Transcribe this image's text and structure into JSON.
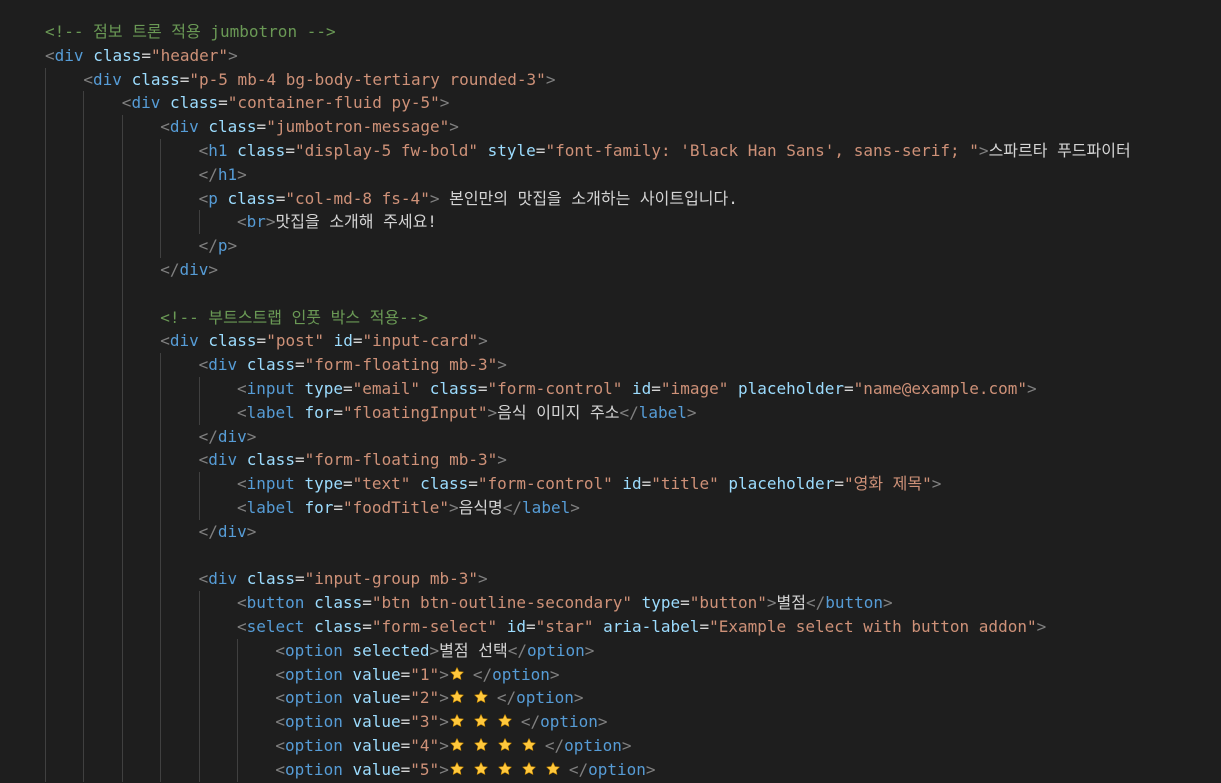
{
  "lines": [
    {
      "indent": 0,
      "tokens": [
        {
          "t": "c",
          "v": "<!-- 점보 트론 적용 jumbotron -->"
        }
      ]
    },
    {
      "indent": 0,
      "tokens": [
        {
          "t": "p",
          "v": "<"
        },
        {
          "t": "g",
          "v": "div"
        },
        {
          "t": "s",
          "v": " "
        },
        {
          "t": "a",
          "v": "class"
        },
        {
          "t": "e",
          "v": "="
        },
        {
          "t": "q",
          "v": "\"header\""
        },
        {
          "t": "p",
          "v": ">"
        }
      ]
    },
    {
      "indent": 1,
      "tokens": [
        {
          "t": "p",
          "v": "<"
        },
        {
          "t": "g",
          "v": "div"
        },
        {
          "t": "s",
          "v": " "
        },
        {
          "t": "a",
          "v": "class"
        },
        {
          "t": "e",
          "v": "="
        },
        {
          "t": "q",
          "v": "\"p-5 mb-4 bg-body-tertiary rounded-3\""
        },
        {
          "t": "p",
          "v": ">"
        }
      ]
    },
    {
      "indent": 2,
      "tokens": [
        {
          "t": "p",
          "v": "<"
        },
        {
          "t": "g",
          "v": "div"
        },
        {
          "t": "s",
          "v": " "
        },
        {
          "t": "a",
          "v": "class"
        },
        {
          "t": "e",
          "v": "="
        },
        {
          "t": "q",
          "v": "\"container-fluid py-5\""
        },
        {
          "t": "p",
          "v": ">"
        }
      ]
    },
    {
      "indent": 3,
      "tokens": [
        {
          "t": "p",
          "v": "<"
        },
        {
          "t": "g",
          "v": "div"
        },
        {
          "t": "s",
          "v": " "
        },
        {
          "t": "a",
          "v": "class"
        },
        {
          "t": "e",
          "v": "="
        },
        {
          "t": "q",
          "v": "\"jumbotron-message\""
        },
        {
          "t": "p",
          "v": ">"
        }
      ]
    },
    {
      "indent": 4,
      "tokens": [
        {
          "t": "p",
          "v": "<"
        },
        {
          "t": "g",
          "v": "h1"
        },
        {
          "t": "s",
          "v": " "
        },
        {
          "t": "a",
          "v": "class"
        },
        {
          "t": "e",
          "v": "="
        },
        {
          "t": "q",
          "v": "\"display-5 fw-bold\""
        },
        {
          "t": "s",
          "v": " "
        },
        {
          "t": "a",
          "v": "style"
        },
        {
          "t": "e",
          "v": "="
        },
        {
          "t": "q",
          "v": "\"font-family: 'Black Han Sans', sans-serif; \""
        },
        {
          "t": "p",
          "v": ">"
        },
        {
          "t": "x",
          "v": "스파르타 푸드파이터"
        }
      ]
    },
    {
      "indent": 4,
      "tokens": [
        {
          "t": "p",
          "v": "</"
        },
        {
          "t": "g",
          "v": "h1"
        },
        {
          "t": "p",
          "v": ">"
        }
      ]
    },
    {
      "indent": 4,
      "tokens": [
        {
          "t": "p",
          "v": "<"
        },
        {
          "t": "g",
          "v": "p"
        },
        {
          "t": "s",
          "v": " "
        },
        {
          "t": "a",
          "v": "class"
        },
        {
          "t": "e",
          "v": "="
        },
        {
          "t": "q",
          "v": "\"col-md-8 fs-4\""
        },
        {
          "t": "p",
          "v": ">"
        },
        {
          "t": "x",
          "v": " 본인만의 맛집을 소개하는 사이트입니다."
        }
      ]
    },
    {
      "indent": 5,
      "tokens": [
        {
          "t": "p",
          "v": "<"
        },
        {
          "t": "g",
          "v": "br"
        },
        {
          "t": "p",
          "v": ">"
        },
        {
          "t": "x",
          "v": "맛집을 소개해 주세요!"
        }
      ]
    },
    {
      "indent": 4,
      "tokens": [
        {
          "t": "p",
          "v": "</"
        },
        {
          "t": "g",
          "v": "p"
        },
        {
          "t": "p",
          "v": ">"
        }
      ]
    },
    {
      "indent": 3,
      "tokens": [
        {
          "t": "p",
          "v": "</"
        },
        {
          "t": "g",
          "v": "div"
        },
        {
          "t": "p",
          "v": ">"
        }
      ]
    },
    {
      "indent": 3,
      "tokens": []
    },
    {
      "indent": 3,
      "tokens": [
        {
          "t": "c",
          "v": "<!-- 부트스트랩 인풋 박스 적용-->"
        }
      ]
    },
    {
      "indent": 3,
      "tokens": [
        {
          "t": "p",
          "v": "<"
        },
        {
          "t": "g",
          "v": "div"
        },
        {
          "t": "s",
          "v": " "
        },
        {
          "t": "a",
          "v": "class"
        },
        {
          "t": "e",
          "v": "="
        },
        {
          "t": "q",
          "v": "\"post\""
        },
        {
          "t": "s",
          "v": " "
        },
        {
          "t": "a",
          "v": "id"
        },
        {
          "t": "e",
          "v": "="
        },
        {
          "t": "q",
          "v": "\"input-card\""
        },
        {
          "t": "p",
          "v": ">"
        }
      ]
    },
    {
      "indent": 4,
      "tokens": [
        {
          "t": "p",
          "v": "<"
        },
        {
          "t": "g",
          "v": "div"
        },
        {
          "t": "s",
          "v": " "
        },
        {
          "t": "a",
          "v": "class"
        },
        {
          "t": "e",
          "v": "="
        },
        {
          "t": "q",
          "v": "\"form-floating mb-3\""
        },
        {
          "t": "p",
          "v": ">"
        }
      ]
    },
    {
      "indent": 5,
      "tokens": [
        {
          "t": "p",
          "v": "<"
        },
        {
          "t": "g",
          "v": "input"
        },
        {
          "t": "s",
          "v": " "
        },
        {
          "t": "a",
          "v": "type"
        },
        {
          "t": "e",
          "v": "="
        },
        {
          "t": "q",
          "v": "\"email\""
        },
        {
          "t": "s",
          "v": " "
        },
        {
          "t": "a",
          "v": "class"
        },
        {
          "t": "e",
          "v": "="
        },
        {
          "t": "q",
          "v": "\"form-control\""
        },
        {
          "t": "s",
          "v": " "
        },
        {
          "t": "a",
          "v": "id"
        },
        {
          "t": "e",
          "v": "="
        },
        {
          "t": "q",
          "v": "\"image\""
        },
        {
          "t": "s",
          "v": " "
        },
        {
          "t": "a",
          "v": "placeholder"
        },
        {
          "t": "e",
          "v": "="
        },
        {
          "t": "q",
          "v": "\"name@example.com\""
        },
        {
          "t": "p",
          "v": ">"
        }
      ]
    },
    {
      "indent": 5,
      "tokens": [
        {
          "t": "p",
          "v": "<"
        },
        {
          "t": "g",
          "v": "label"
        },
        {
          "t": "s",
          "v": " "
        },
        {
          "t": "a",
          "v": "for"
        },
        {
          "t": "e",
          "v": "="
        },
        {
          "t": "q",
          "v": "\"floatingInput\""
        },
        {
          "t": "p",
          "v": ">"
        },
        {
          "t": "x",
          "v": "음식 이미지 주소"
        },
        {
          "t": "p",
          "v": "</"
        },
        {
          "t": "g",
          "v": "label"
        },
        {
          "t": "p",
          "v": ">"
        }
      ]
    },
    {
      "indent": 4,
      "tokens": [
        {
          "t": "p",
          "v": "</"
        },
        {
          "t": "g",
          "v": "div"
        },
        {
          "t": "p",
          "v": ">"
        }
      ]
    },
    {
      "indent": 4,
      "tokens": [
        {
          "t": "p",
          "v": "<"
        },
        {
          "t": "g",
          "v": "div"
        },
        {
          "t": "s",
          "v": " "
        },
        {
          "t": "a",
          "v": "class"
        },
        {
          "t": "e",
          "v": "="
        },
        {
          "t": "q",
          "v": "\"form-floating mb-3\""
        },
        {
          "t": "p",
          "v": ">"
        }
      ]
    },
    {
      "indent": 5,
      "tokens": [
        {
          "t": "p",
          "v": "<"
        },
        {
          "t": "g",
          "v": "input"
        },
        {
          "t": "s",
          "v": " "
        },
        {
          "t": "a",
          "v": "type"
        },
        {
          "t": "e",
          "v": "="
        },
        {
          "t": "q",
          "v": "\"text\""
        },
        {
          "t": "s",
          "v": " "
        },
        {
          "t": "a",
          "v": "class"
        },
        {
          "t": "e",
          "v": "="
        },
        {
          "t": "q",
          "v": "\"form-control\""
        },
        {
          "t": "s",
          "v": " "
        },
        {
          "t": "a",
          "v": "id"
        },
        {
          "t": "e",
          "v": "="
        },
        {
          "t": "q",
          "v": "\"title\""
        },
        {
          "t": "s",
          "v": " "
        },
        {
          "t": "a",
          "v": "placeholder"
        },
        {
          "t": "e",
          "v": "="
        },
        {
          "t": "q",
          "v": "\"영화 제목\""
        },
        {
          "t": "p",
          "v": ">"
        }
      ]
    },
    {
      "indent": 5,
      "tokens": [
        {
          "t": "p",
          "v": "<"
        },
        {
          "t": "g",
          "v": "label"
        },
        {
          "t": "s",
          "v": " "
        },
        {
          "t": "a",
          "v": "for"
        },
        {
          "t": "e",
          "v": "="
        },
        {
          "t": "q",
          "v": "\"foodTitle\""
        },
        {
          "t": "p",
          "v": ">"
        },
        {
          "t": "x",
          "v": "음식명"
        },
        {
          "t": "p",
          "v": "</"
        },
        {
          "t": "g",
          "v": "label"
        },
        {
          "t": "p",
          "v": ">"
        }
      ]
    },
    {
      "indent": 4,
      "tokens": [
        {
          "t": "p",
          "v": "</"
        },
        {
          "t": "g",
          "v": "div"
        },
        {
          "t": "p",
          "v": ">"
        }
      ]
    },
    {
      "indent": 4,
      "tokens": []
    },
    {
      "indent": 4,
      "tokens": [
        {
          "t": "p",
          "v": "<"
        },
        {
          "t": "g",
          "v": "div"
        },
        {
          "t": "s",
          "v": " "
        },
        {
          "t": "a",
          "v": "class"
        },
        {
          "t": "e",
          "v": "="
        },
        {
          "t": "q",
          "v": "\"input-group mb-3\""
        },
        {
          "t": "p",
          "v": ">"
        }
      ]
    },
    {
      "indent": 5,
      "tokens": [
        {
          "t": "p",
          "v": "<"
        },
        {
          "t": "g",
          "v": "button"
        },
        {
          "t": "s",
          "v": " "
        },
        {
          "t": "a",
          "v": "class"
        },
        {
          "t": "e",
          "v": "="
        },
        {
          "t": "q",
          "v": "\"btn btn-outline-secondary\""
        },
        {
          "t": "s",
          "v": " "
        },
        {
          "t": "a",
          "v": "type"
        },
        {
          "t": "e",
          "v": "="
        },
        {
          "t": "q",
          "v": "\"button\""
        },
        {
          "t": "p",
          "v": ">"
        },
        {
          "t": "x",
          "v": "별점"
        },
        {
          "t": "p",
          "v": "</"
        },
        {
          "t": "g",
          "v": "button"
        },
        {
          "t": "p",
          "v": ">"
        }
      ]
    },
    {
      "indent": 5,
      "tokens": [
        {
          "t": "p",
          "v": "<"
        },
        {
          "t": "g",
          "v": "select"
        },
        {
          "t": "s",
          "v": " "
        },
        {
          "t": "a",
          "v": "class"
        },
        {
          "t": "e",
          "v": "="
        },
        {
          "t": "q",
          "v": "\"form-select\""
        },
        {
          "t": "s",
          "v": " "
        },
        {
          "t": "a",
          "v": "id"
        },
        {
          "t": "e",
          "v": "="
        },
        {
          "t": "q",
          "v": "\"star\""
        },
        {
          "t": "s",
          "v": " "
        },
        {
          "t": "a",
          "v": "aria-label"
        },
        {
          "t": "e",
          "v": "="
        },
        {
          "t": "q",
          "v": "\"Example select with button addon\""
        },
        {
          "t": "p",
          "v": ">"
        }
      ]
    },
    {
      "indent": 6,
      "tokens": [
        {
          "t": "p",
          "v": "<"
        },
        {
          "t": "g",
          "v": "option"
        },
        {
          "t": "s",
          "v": " "
        },
        {
          "t": "a",
          "v": "selected"
        },
        {
          "t": "p",
          "v": ">"
        },
        {
          "t": "x",
          "v": "별점 선택"
        },
        {
          "t": "p",
          "v": "</"
        },
        {
          "t": "g",
          "v": "option"
        },
        {
          "t": "p",
          "v": ">"
        }
      ]
    },
    {
      "indent": 6,
      "tokens": [
        {
          "t": "p",
          "v": "<"
        },
        {
          "t": "g",
          "v": "option"
        },
        {
          "t": "s",
          "v": " "
        },
        {
          "t": "a",
          "v": "value"
        },
        {
          "t": "e",
          "v": "="
        },
        {
          "t": "q",
          "v": "\"1\""
        },
        {
          "t": "p",
          "v": ">"
        },
        {
          "t": "star",
          "v": 1
        },
        {
          "t": "p",
          "v": "</"
        },
        {
          "t": "g",
          "v": "option"
        },
        {
          "t": "p",
          "v": ">"
        }
      ]
    },
    {
      "indent": 6,
      "tokens": [
        {
          "t": "p",
          "v": "<"
        },
        {
          "t": "g",
          "v": "option"
        },
        {
          "t": "s",
          "v": " "
        },
        {
          "t": "a",
          "v": "value"
        },
        {
          "t": "e",
          "v": "="
        },
        {
          "t": "q",
          "v": "\"2\""
        },
        {
          "t": "p",
          "v": ">"
        },
        {
          "t": "star",
          "v": 2
        },
        {
          "t": "p",
          "v": "</"
        },
        {
          "t": "g",
          "v": "option"
        },
        {
          "t": "p",
          "v": ">"
        }
      ]
    },
    {
      "indent": 6,
      "tokens": [
        {
          "t": "p",
          "v": "<"
        },
        {
          "t": "g",
          "v": "option"
        },
        {
          "t": "s",
          "v": " "
        },
        {
          "t": "a",
          "v": "value"
        },
        {
          "t": "e",
          "v": "="
        },
        {
          "t": "q",
          "v": "\"3\""
        },
        {
          "t": "p",
          "v": ">"
        },
        {
          "t": "star",
          "v": 3
        },
        {
          "t": "p",
          "v": "</"
        },
        {
          "t": "g",
          "v": "option"
        },
        {
          "t": "p",
          "v": ">"
        }
      ]
    },
    {
      "indent": 6,
      "tokens": [
        {
          "t": "p",
          "v": "<"
        },
        {
          "t": "g",
          "v": "option"
        },
        {
          "t": "s",
          "v": " "
        },
        {
          "t": "a",
          "v": "value"
        },
        {
          "t": "e",
          "v": "="
        },
        {
          "t": "q",
          "v": "\"4\""
        },
        {
          "t": "p",
          "v": ">"
        },
        {
          "t": "star",
          "v": 4
        },
        {
          "t": "p",
          "v": "</"
        },
        {
          "t": "g",
          "v": "option"
        },
        {
          "t": "p",
          "v": ">"
        }
      ]
    },
    {
      "indent": 6,
      "tokens": [
        {
          "t": "p",
          "v": "<"
        },
        {
          "t": "g",
          "v": "option"
        },
        {
          "t": "s",
          "v": " "
        },
        {
          "t": "a",
          "v": "value"
        },
        {
          "t": "e",
          "v": "="
        },
        {
          "t": "q",
          "v": "\"5\""
        },
        {
          "t": "p",
          "v": ">"
        },
        {
          "t": "star",
          "v": 5
        },
        {
          "t": "p",
          "v": "</"
        },
        {
          "t": "g",
          "v": "option"
        },
        {
          "t": "p",
          "v": ">"
        }
      ]
    }
  ],
  "colors": {
    "background": "#1e1e1e",
    "comment": "#6a9955",
    "tag": "#569cd6",
    "punctuation": "#808080",
    "attribute": "#9cdcfe",
    "string": "#ce9178",
    "text": "#d4d4d4",
    "indent_guide": "#404040",
    "star": "#ffc83d"
  },
  "icons": {
    "star": "star-emoji-icon"
  }
}
